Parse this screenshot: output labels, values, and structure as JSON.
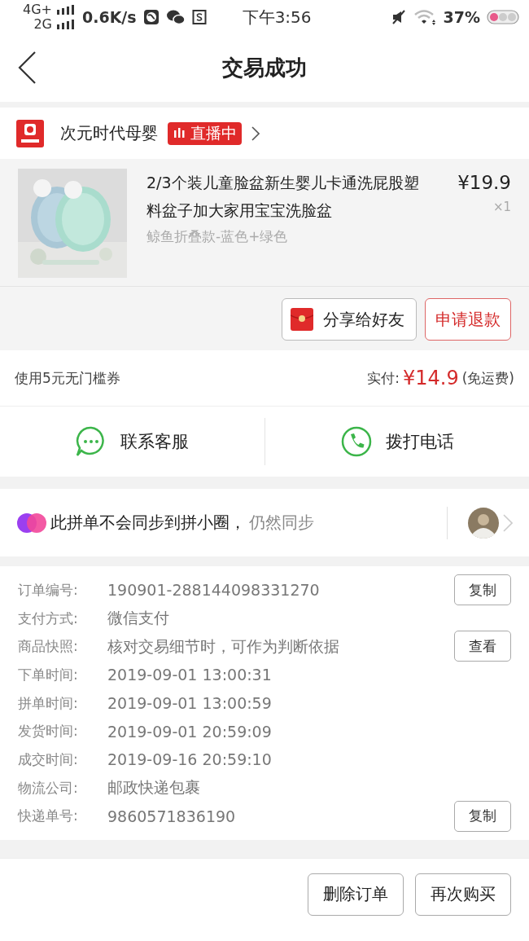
{
  "status_bar": {
    "network_top": "4G+",
    "network_bottom": "2G",
    "speed": "0.6K/s",
    "time": "下午3:56",
    "battery": "37%"
  },
  "header": {
    "title": "交易成功"
  },
  "shop": {
    "name": "次元时代母婴",
    "live_badge": "直播中"
  },
  "product": {
    "title": "2/3个装儿童脸盆新生婴儿卡通洗屁股塑料盆子加大家用宝宝洗脸盆",
    "variant": "鲸鱼折叠款-蓝色+绿色",
    "price": "¥19.9",
    "quantity": "×1"
  },
  "product_actions": [
    {
      "label": "分享给好友",
      "kind": "share"
    },
    {
      "label": "申请退款",
      "kind": "refund"
    }
  ],
  "payment": {
    "coupon": "使用5元无门槛券",
    "paid_label": "实付:",
    "paid_amount": "¥14.9",
    "shipping_note": "(免运费)"
  },
  "contact_actions": [
    {
      "label": "联系客服",
      "kind": "chat"
    },
    {
      "label": "拨打电话",
      "kind": "phone"
    }
  ],
  "sync_notice": {
    "text": "此拼单不会同步到拼小圈，",
    "link": "仍然同步"
  },
  "order_details": [
    {
      "label": "订单编号:",
      "value": "190901-288144098331270",
      "button": "复制"
    },
    {
      "label": "支付方式:",
      "value": "微信支付"
    },
    {
      "label": "商品快照:",
      "value": "核对交易细节时，可作为判断依据",
      "button": "查看"
    },
    {
      "label": "下单时间:",
      "value": "2019-09-01 13:00:31"
    },
    {
      "label": "拼单时间:",
      "value": "2019-09-01 13:00:59"
    },
    {
      "label": "发货时间:",
      "value": "2019-09-01 20:59:09"
    },
    {
      "label": "成交时间:",
      "value": "2019-09-16 20:59:10"
    },
    {
      "label": "物流公司:",
      "value": "邮政快递包裹"
    },
    {
      "label": "快递单号:",
      "value": "9860571836190",
      "button": "复制"
    }
  ],
  "bottom_actions": [
    "删除订单",
    "再次购买"
  ]
}
